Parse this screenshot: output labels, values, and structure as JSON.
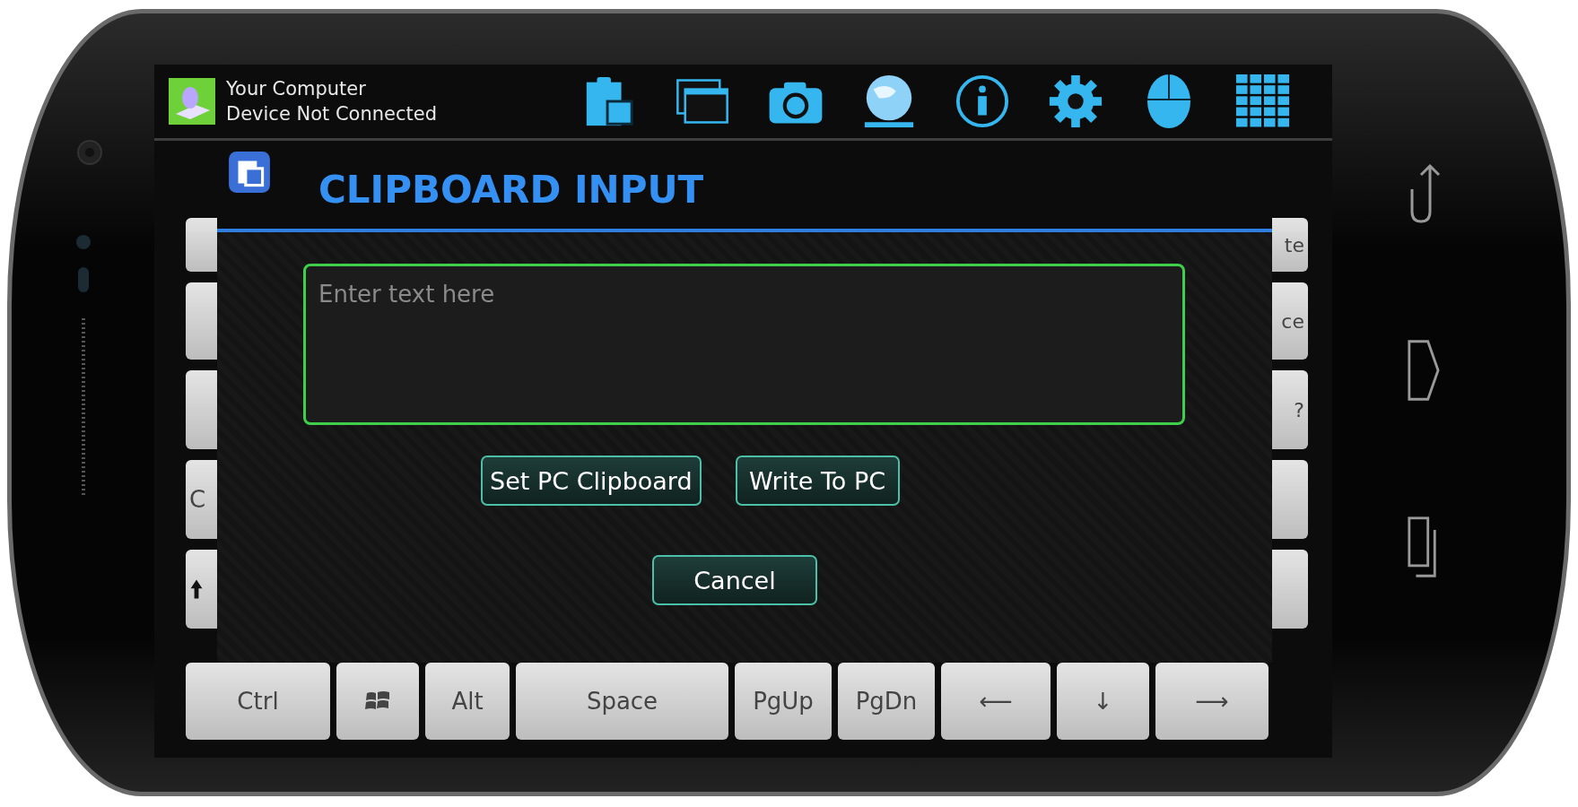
{
  "status": {
    "title": "Your Computer",
    "subtitle": "Device Not Connected"
  },
  "dialog": {
    "title": "CLIPBOARD INPUT",
    "input": {
      "placeholder": "Enter text here"
    },
    "buttons": [
      "Set PC Clipboard",
      "Write To PC"
    ],
    "cancel": "Cancel"
  },
  "left_keys": [
    {
      "kind": "blank"
    },
    {
      "kind": "blank"
    },
    {
      "kind": "blank"
    },
    {
      "kind": "text",
      "label": "C"
    },
    {
      "kind": "shift"
    }
  ],
  "right_keys": [
    {
      "kind": "text",
      "label": "te"
    },
    {
      "kind": "text",
      "label": "ce"
    },
    {
      "kind": "text",
      "label": "?"
    },
    {
      "kind": "blank"
    },
    {
      "kind": "blank"
    }
  ],
  "bottom_keys": [
    {
      "kind": "text",
      "label": "Ctrl"
    },
    {
      "kind": "windows"
    },
    {
      "kind": "text",
      "label": "Alt"
    },
    {
      "kind": "text",
      "label": "Space"
    },
    {
      "kind": "text",
      "label": "PgUp"
    },
    {
      "kind": "text",
      "label": "PgDn"
    },
    {
      "kind": "text",
      "label": "⟵"
    },
    {
      "kind": "text",
      "label": "↓"
    },
    {
      "kind": "text",
      "label": "⟶"
    }
  ]
}
